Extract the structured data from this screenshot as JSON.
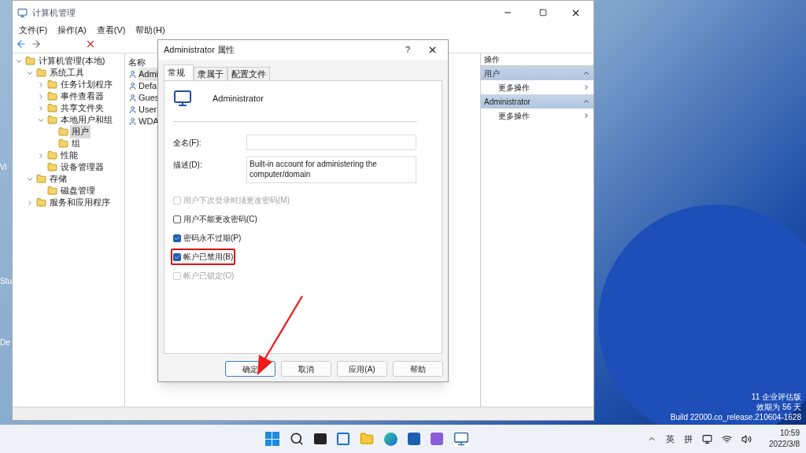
{
  "main_window": {
    "title": "计算机管理",
    "menu": [
      "文件(F)",
      "操作(A)",
      "查看(V)",
      "帮助(H)"
    ],
    "tree": [
      {
        "label": "计算机管理(本地)",
        "expanded": true,
        "selected": false,
        "children": [
          {
            "label": "系统工具",
            "expanded": true,
            "selected": false,
            "children": [
              {
                "label": "任务计划程序",
                "expanded": false,
                "selected": false
              },
              {
                "label": "事件查看器",
                "expanded": false,
                "selected": false
              },
              {
                "label": "共享文件夹",
                "expanded": false,
                "selected": false
              },
              {
                "label": "本地用户和组",
                "expanded": true,
                "selected": false,
                "children": [
                  {
                    "label": "用户",
                    "selected": true
                  },
                  {
                    "label": "组",
                    "selected": false
                  }
                ]
              },
              {
                "label": "性能",
                "expanded": false,
                "selected": false
              },
              {
                "label": "设备管理器",
                "selected": false
              }
            ]
          },
          {
            "label": "存储",
            "expanded": true,
            "selected": false,
            "children": [
              {
                "label": "磁盘管理",
                "selected": false
              }
            ]
          },
          {
            "label": "服务和应用程序",
            "expanded": false,
            "selected": false
          }
        ]
      }
    ],
    "list": {
      "column_1": "名称",
      "rows": [
        {
          "name": "Admi",
          "selected": true
        },
        {
          "name": "Defa",
          "selected": false
        },
        {
          "name": "Gues",
          "selected": false
        },
        {
          "name": "User",
          "selected": false
        },
        {
          "name": "WDA",
          "selected": false
        }
      ]
    },
    "actions": {
      "title": "操作",
      "sections": [
        {
          "header": "用户",
          "items": [
            "更多操作"
          ]
        },
        {
          "header": "Administrator",
          "items": [
            "更多操作"
          ]
        }
      ]
    }
  },
  "dialog": {
    "title": "Administrator 属性",
    "help": "?",
    "tabs": [
      {
        "label": "常规",
        "selected": true
      },
      {
        "label": "隶属于",
        "selected": false
      },
      {
        "label": "配置文件",
        "selected": false
      }
    ],
    "user_name": "Administrator",
    "fields": [
      {
        "label": "全名(F):"
      },
      {
        "label": "描述(D):",
        "value": "Built-in account for administering the computer/domain"
      }
    ],
    "checkboxes": [
      {
        "label": "用户下次登录时须更改密码(M)",
        "checked": false,
        "disabled": true,
        "highlighted": false
      },
      {
        "label": "用户不能更改密码(C)",
        "checked": false,
        "disabled": false,
        "highlighted": false
      },
      {
        "label": "密码永不过期(P)",
        "checked": true,
        "disabled": false,
        "highlighted": false
      },
      {
        "label": "帐户已禁用(B)",
        "checked": true,
        "disabled": false,
        "highlighted": true
      },
      {
        "label": "帐户已锁定(O)",
        "checked": false,
        "disabled": true,
        "highlighted": false
      }
    ],
    "buttons": [
      {
        "label": "确定",
        "default": true
      },
      {
        "label": "取消",
        "default": false
      },
      {
        "label": "应用(A)",
        "default": false
      },
      {
        "label": "帮助",
        "default": false
      }
    ]
  },
  "desktop": {
    "icon_labels": [
      "Vi",
      "Stu",
      "De"
    ],
    "edition_lines": [
      "11 企业评估版",
      "效期为 56 天",
      "Build 22000.co_release.210604-1628"
    ]
  },
  "taskbar": {
    "tray": [
      "英",
      "拼"
    ],
    "time": "10:59",
    "date": "2022/3/8"
  }
}
